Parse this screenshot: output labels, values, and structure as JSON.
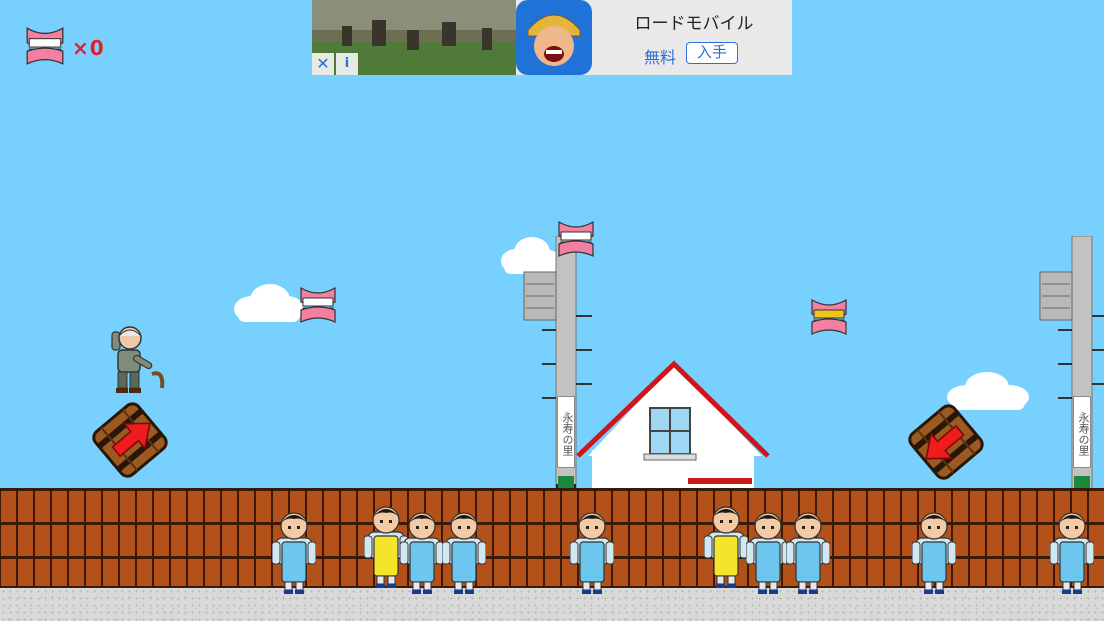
{
  "hud": {
    "icon": "dentures-icon",
    "count_text": "×0"
  },
  "ad": {
    "title": "ロードモバイル",
    "price": "無料",
    "get_label": "入手",
    "close_glyph": "✕",
    "info_glyph": "i"
  },
  "scene": {
    "sign_text": "永寿の里",
    "sky_color": "#77d0fd",
    "fence_color": "#b3511a",
    "items": [
      {
        "name": "dentures-pink-1",
        "type": "dentures"
      },
      {
        "name": "dentures-pink-2",
        "type": "dentures"
      },
      {
        "name": "dentures-gold",
        "type": "golden-dentures"
      }
    ],
    "barrels": [
      "barrel-launch-up-right",
      "barrel-launch-down-left"
    ],
    "caregivers": [
      {
        "apron": "blue"
      },
      {
        "apron": "yellow"
      },
      {
        "apron": "blue"
      },
      {
        "apron": "blue"
      },
      {
        "apron": "blue"
      },
      {
        "apron": "yellow"
      },
      {
        "apron": "blue"
      },
      {
        "apron": "blue"
      },
      {
        "apron": "blue"
      },
      {
        "apron": "blue"
      }
    ]
  }
}
